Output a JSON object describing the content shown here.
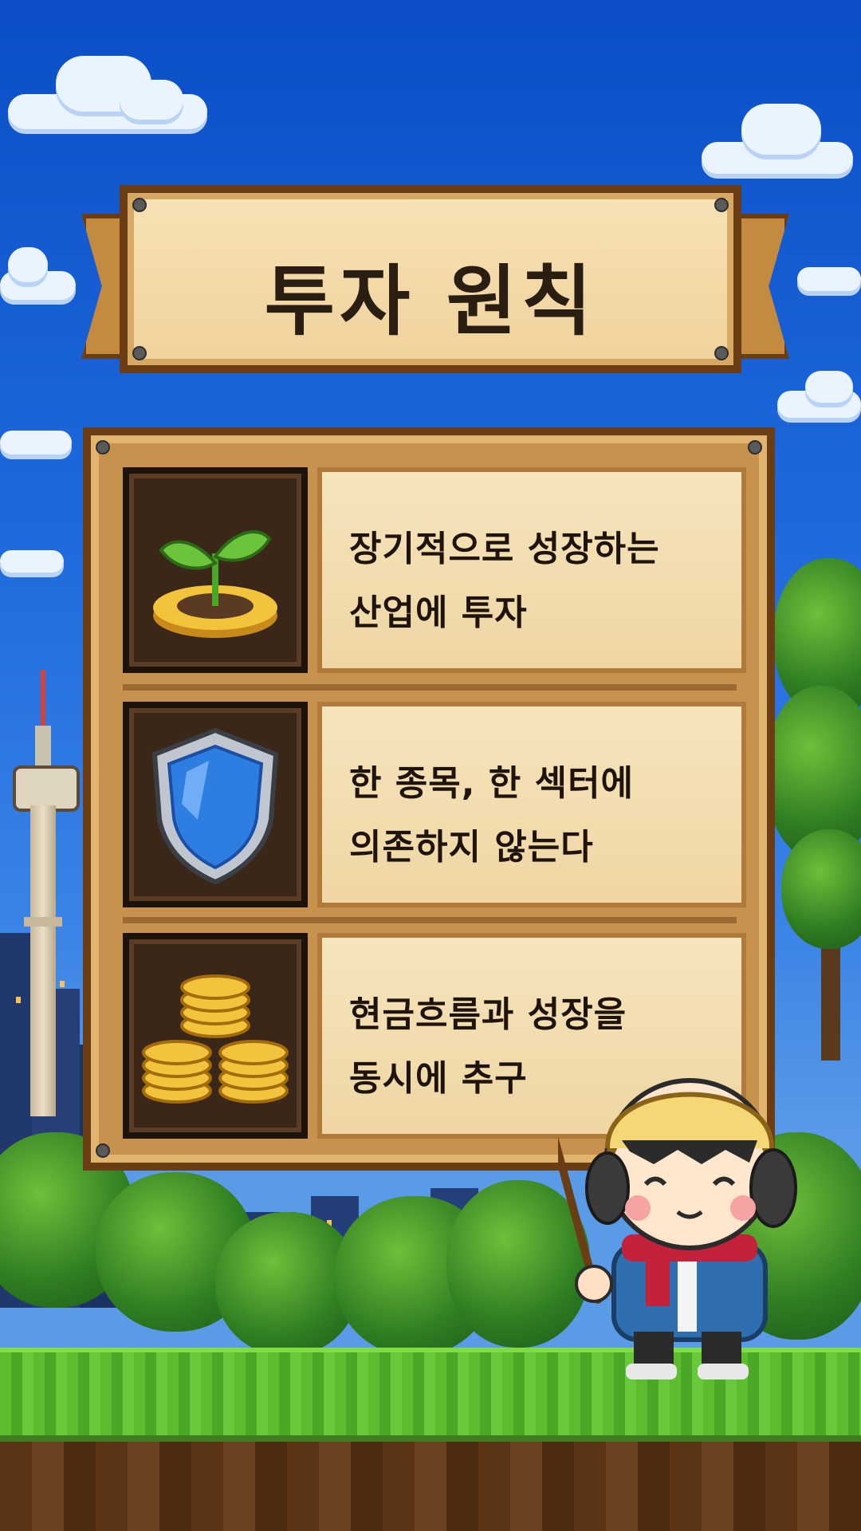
{
  "title": "투자 원칙",
  "principles": [
    {
      "icon": "sprout-on-coins-icon",
      "lines": [
        "장기적으로 성장하는",
        "산업에 투자"
      ]
    },
    {
      "icon": "shield-icon",
      "lines": [
        "한 종목, 한 섹터에",
        "의존하지 않는다"
      ]
    },
    {
      "icon": "gold-coin-stacks-icon",
      "lines": [
        "현금흐름과 성장을",
        "동시에 추구"
      ]
    }
  ],
  "colors": {
    "sky": "#1f69dd",
    "panel_wood": "#c7924d",
    "parchment": "#f6e4bd",
    "text": "#1f140b",
    "grass": "#5cbd2f"
  }
}
